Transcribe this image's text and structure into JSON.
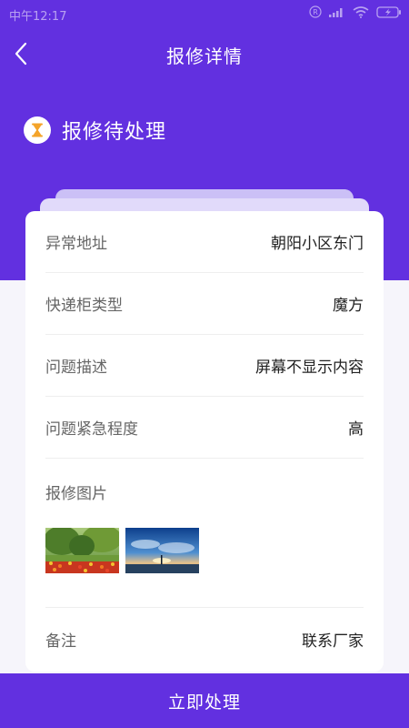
{
  "status_bar": {
    "time": "中午12:17"
  },
  "header": {
    "title": "报修详情",
    "back_icon": "chevron-left-icon"
  },
  "ticket_status": {
    "icon": "hourglass-icon",
    "label": "报修待处理"
  },
  "details": [
    {
      "label": "异常地址",
      "value": "朝阳小区东门"
    },
    {
      "label": "快递柜类型",
      "value": "魔方"
    },
    {
      "label": "问题描述",
      "value": "屏幕不显示内容"
    },
    {
      "label": "问题紧急程度",
      "value": "高"
    }
  ],
  "photos": {
    "label": "报修图片",
    "items": [
      "flower-garden-photo",
      "sky-sunrise-photo"
    ]
  },
  "remark": {
    "label": "备注",
    "value": "联系厂家"
  },
  "action": {
    "label": "立即处理"
  },
  "colors": {
    "primary": "#6230e0",
    "accent": "#f4a42a"
  }
}
